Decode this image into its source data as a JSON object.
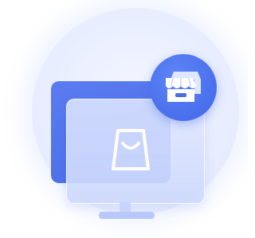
{
  "illustration": {
    "type": "online-store",
    "icons": [
      "shopping-bag-icon",
      "storefront-icon"
    ],
    "colors": {
      "accent": "#4a6ce8",
      "panel": "#dfe6ff",
      "badge": "#3f66ea",
      "background_circle": "#e9eeff",
      "icon_stroke": "#ffffff"
    }
  }
}
